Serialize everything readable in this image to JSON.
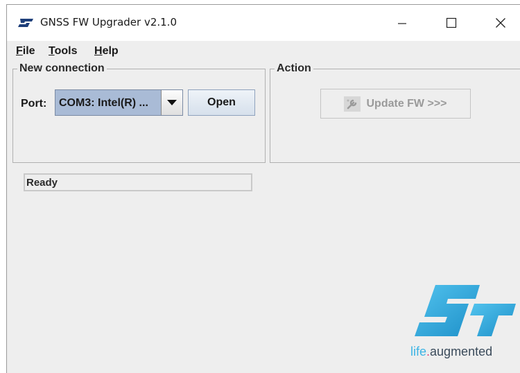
{
  "window": {
    "title": "GNSS FW Upgrader v2.1.0"
  },
  "menu": {
    "file": {
      "mnemonic": "F",
      "rest": "ile"
    },
    "tools": {
      "mnemonic": "T",
      "rest": "ools"
    },
    "help": {
      "mnemonic": "H",
      "rest": "elp"
    }
  },
  "connection": {
    "group_title": "New connection",
    "port_label": "Port:",
    "port_value": "COM3: Intel(R) ...",
    "open_label": "Open"
  },
  "action": {
    "group_title": "Action",
    "update_label": "Update FW >>>",
    "update_enabled": false
  },
  "status": {
    "text": "Ready"
  },
  "logo": {
    "brand_color": "#3cb4e5",
    "tagline_part1": "life",
    "tagline_dot": ".",
    "tagline_part2": "augmented"
  },
  "icons": [
    "st-logo-icon",
    "minimize-icon",
    "maximize-icon",
    "close-icon",
    "dropdown-arrow-icon",
    "wrench-icon"
  ]
}
